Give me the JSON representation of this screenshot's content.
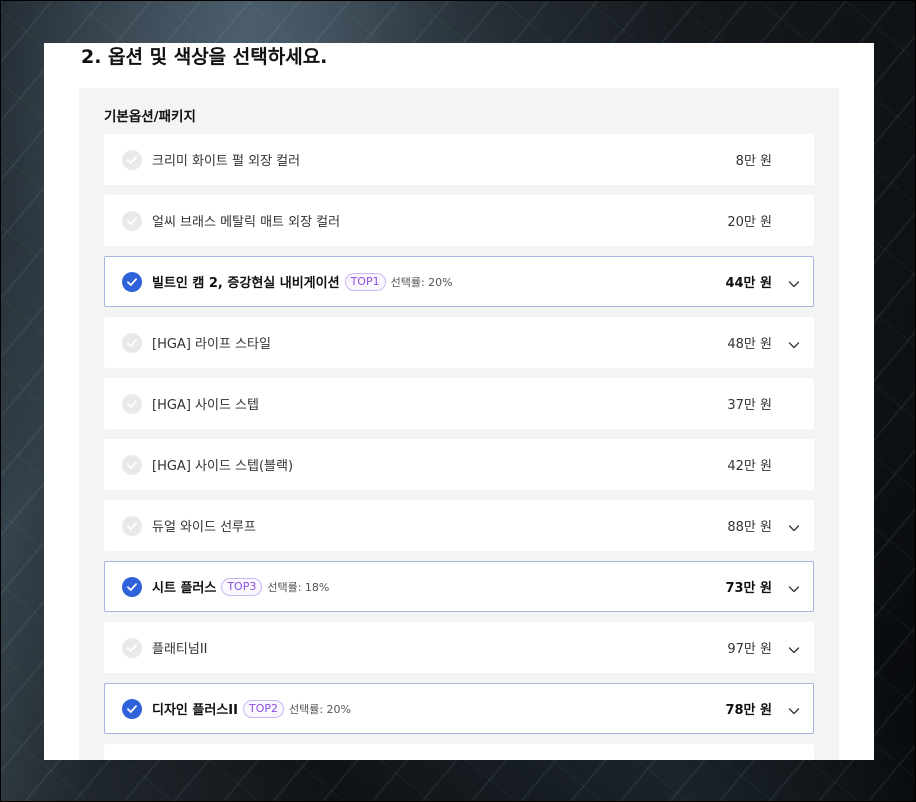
{
  "section": {
    "title": "2. 옵션 및 색상을 선택하세요."
  },
  "group": {
    "title": "기본옵션/패키지"
  },
  "options": [
    {
      "name": "크리미 화이트 펄 외장 컬러",
      "price": "8만 원",
      "selected": false,
      "expandable": false,
      "badge": "",
      "rate": ""
    },
    {
      "name": "얼씨 브래스 메탈릭 매트 외장 컬러",
      "price": "20만 원",
      "selected": false,
      "expandable": false,
      "badge": "",
      "rate": ""
    },
    {
      "name": "빌트인 캠 2, 증강현실 내비게이션",
      "price": "44만 원",
      "selected": true,
      "expandable": true,
      "badge": "TOP1",
      "rate": "선택률: 20%"
    },
    {
      "name": "[HGA] 라이프 스타일",
      "price": "48만 원",
      "selected": false,
      "expandable": true,
      "badge": "",
      "rate": ""
    },
    {
      "name": "[HGA] 사이드 스텝",
      "price": "37만 원",
      "selected": false,
      "expandable": false,
      "badge": "",
      "rate": ""
    },
    {
      "name": "[HGA] 사이드 스텝(블랙)",
      "price": "42만 원",
      "selected": false,
      "expandable": false,
      "badge": "",
      "rate": ""
    },
    {
      "name": "듀얼 와이드 선루프",
      "price": "88만 원",
      "selected": false,
      "expandable": true,
      "badge": "",
      "rate": ""
    },
    {
      "name": "시트 플러스",
      "price": "73만 원",
      "selected": true,
      "expandable": true,
      "badge": "TOP3",
      "rate": "선택률: 18%"
    },
    {
      "name": "플래티넘II",
      "price": "97만 원",
      "selected": false,
      "expandable": true,
      "badge": "",
      "rate": ""
    },
    {
      "name": "디자인 플러스II",
      "price": "78만 원",
      "selected": true,
      "expandable": true,
      "badge": "TOP2",
      "rate": "선택률: 20%"
    },
    {
      "name": "",
      "price": "",
      "selected": false,
      "expandable": false,
      "badge": "",
      "rate": ""
    }
  ],
  "colors": {
    "selected_check": "#2f62d8",
    "selected_border": "#a8b6e0",
    "badge_text": "#8a50e0"
  },
  "icons": {
    "check": "check-icon",
    "expand": "chevron-down-icon"
  }
}
